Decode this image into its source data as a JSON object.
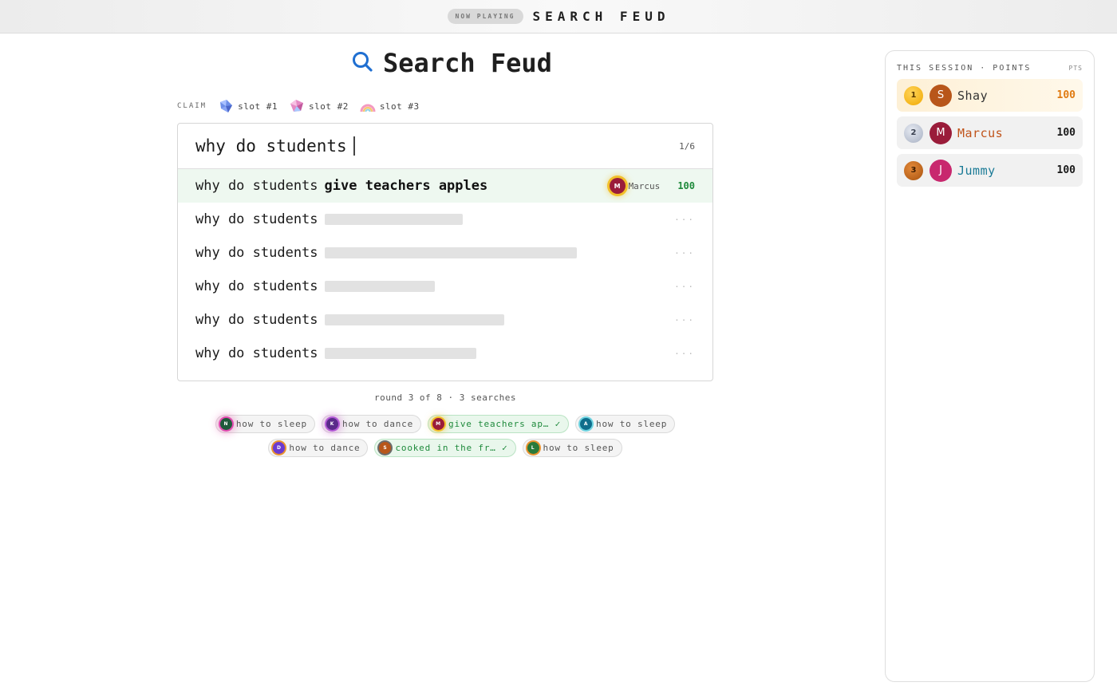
{
  "topbar": {
    "badge": "NOW PLAYING",
    "title": "SEARCH FEUD"
  },
  "heading": {
    "title": "Search Feud",
    "icon": "search-icon",
    "icon_color": "#1f6fd1"
  },
  "claim": {
    "label": "CLAIM",
    "slots": [
      {
        "label": "slot #1",
        "icon": "blue-gem-icon"
      },
      {
        "label": "slot #2",
        "icon": "pink-gem-icon"
      },
      {
        "label": "slot #3",
        "icon": "rainbow-arch-icon"
      }
    ]
  },
  "search": {
    "query": "why do students",
    "counter": "1/6",
    "answers": [
      {
        "prefix": "why do students",
        "completion": "give teachers apples",
        "revealed": true,
        "claimer_initial": "M",
        "claimer_name": "Marcus",
        "points": "100"
      },
      {
        "prefix": "why do students",
        "revealed": false,
        "hidden_length": 0.26,
        "placeholder": "···"
      },
      {
        "prefix": "why do students",
        "revealed": false,
        "hidden_length": 0.47,
        "placeholder": "···"
      },
      {
        "prefix": "why do students",
        "revealed": false,
        "hidden_length": 0.21,
        "placeholder": "···"
      },
      {
        "prefix": "why do students",
        "revealed": false,
        "hidden_length": 0.34,
        "placeholder": "···"
      },
      {
        "prefix": "why do students",
        "revealed": false,
        "hidden_length": 0.28,
        "placeholder": "···"
      }
    ]
  },
  "round": {
    "text": "round 3 of 8 · 3 searches"
  },
  "guesses": [
    {
      "initial": "N",
      "text": "how to sleep",
      "hit": false,
      "avatar_color": "#1e5a3a"
    },
    {
      "initial": "K",
      "text": "how to dance",
      "hit": false,
      "avatar_color": "#5a2a8a"
    },
    {
      "initial": "M",
      "text": "give teachers ap… ✓",
      "hit": true,
      "avatar_color": "#9a1c3a"
    },
    {
      "initial": "A",
      "text": "how to sleep",
      "hit": false,
      "avatar_color": "#0f6e8c"
    },
    {
      "initial": "D",
      "text": "how to dance",
      "hit": false,
      "avatar_color": "#6a3ad0"
    },
    {
      "initial": "S",
      "text": "cooked in the fr… ✓",
      "hit": true,
      "avatar_color": "#b8561a"
    },
    {
      "initial": "L",
      "text": "how to sleep",
      "hit": false,
      "avatar_color": "#2a7a3a"
    }
  ],
  "sidebar": {
    "title": "THIS SESSION · POINTS",
    "pts_label": "PTS",
    "players": [
      {
        "rank": "1",
        "initial": "S",
        "name": "Shay",
        "score": "100",
        "avatar_color": "#b8561a",
        "name_color": "#333333",
        "score_color": "#e07b12"
      },
      {
        "rank": "2",
        "initial": "M",
        "name": "Marcus",
        "score": "100",
        "avatar_color": "#9a1c3a",
        "name_color": "#c0531a",
        "score_color": "#1a1a1a"
      },
      {
        "rank": "3",
        "initial": "J",
        "name": "Jummy",
        "score": "100",
        "avatar_color": "#c8286e",
        "name_color": "#1a7a96",
        "score_color": "#1a1a1a"
      }
    ]
  }
}
